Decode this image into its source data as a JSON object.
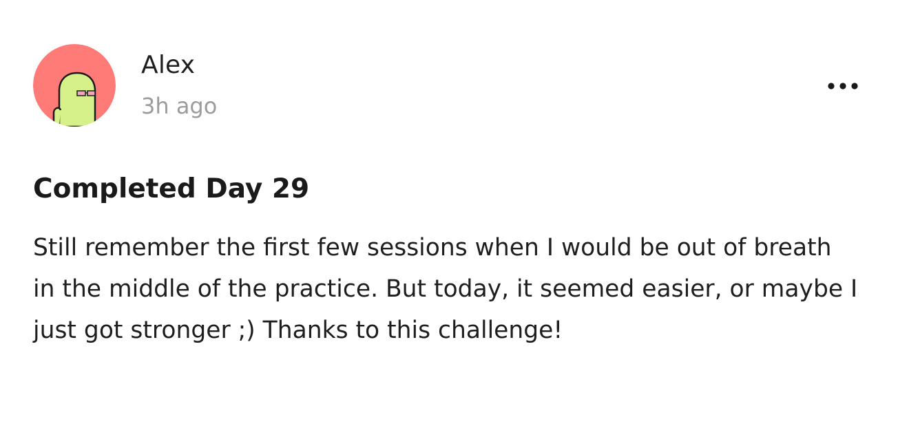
{
  "post": {
    "author": {
      "name": "Alex",
      "avatar_icon": "cactus-avatar-icon",
      "avatar_background": "#ff7b78",
      "avatar_figure_color": "#d6f18a"
    },
    "timestamp": "3h ago",
    "more_icon": "more-horizontal-icon",
    "title": "Completed Day 29",
    "body": "Still remember the first few sessions when I would be out of breath in the middle of the practice. But today, it seemed easier, or maybe I just got stronger ;) Thanks to this challenge!"
  }
}
